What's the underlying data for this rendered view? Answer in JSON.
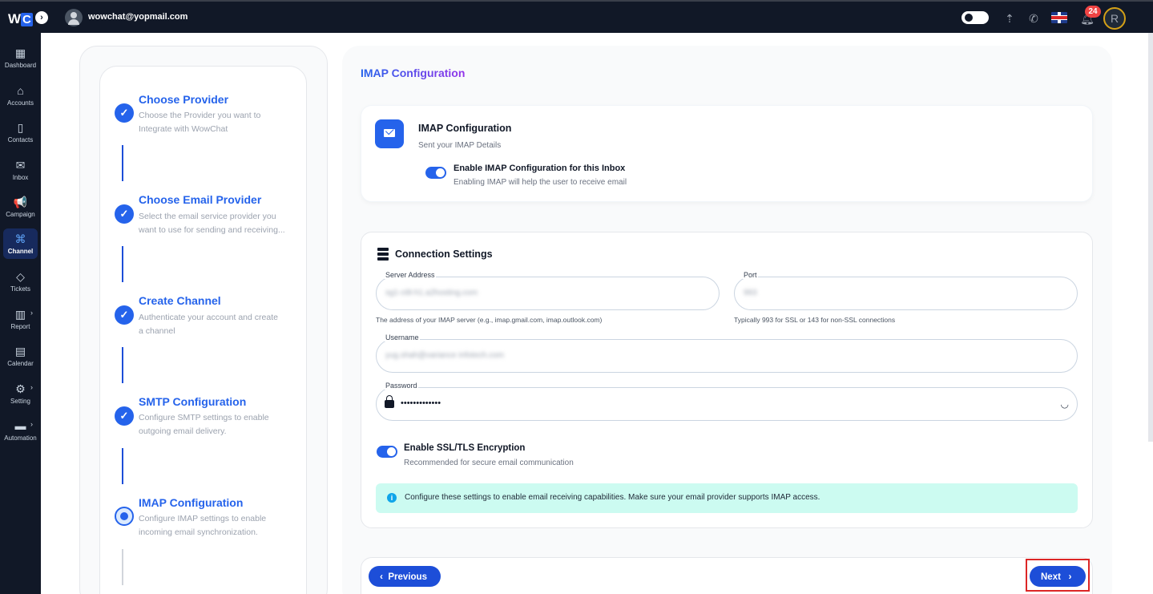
{
  "topbar": {
    "logo_w": "W",
    "logo_c": "C",
    "logo_toggle": "›",
    "user_email": "wowchat@yopmail.com",
    "notification_count": "24",
    "profile_initial": "R"
  },
  "sidebar": {
    "items": [
      {
        "label": "Dashboard",
        "icon": "dashboard-icon",
        "glyph": "▦"
      },
      {
        "label": "Accounts",
        "icon": "home-icon",
        "glyph": "⌂"
      },
      {
        "label": "Contacts",
        "icon": "contacts-icon",
        "glyph": "▯"
      },
      {
        "label": "Inbox",
        "icon": "inbox-icon",
        "glyph": "✉"
      },
      {
        "label": "Campaign",
        "icon": "campaign-icon",
        "glyph": "📢"
      },
      {
        "label": "Channel",
        "icon": "channel-icon",
        "glyph": "⌘"
      },
      {
        "label": "Tickets",
        "icon": "ticket-icon",
        "glyph": "◇"
      },
      {
        "label": "Report",
        "icon": "report-icon",
        "glyph": "▥"
      },
      {
        "label": "Calendar",
        "icon": "calendar-icon",
        "glyph": "▤"
      },
      {
        "label": "Setting",
        "icon": "gear-icon",
        "glyph": "⚙"
      },
      {
        "label": "Automation",
        "icon": "automation-icon",
        "glyph": "▬"
      }
    ]
  },
  "stepper": {
    "steps": [
      {
        "title": "Choose Provider",
        "desc1": "Choose the Provider you want to",
        "desc2": "Integrate with WowChat",
        "status": "done"
      },
      {
        "title": "Choose Email Provider",
        "desc1": "Select the email service provider you",
        "desc2": "want to use for sending and receiving...",
        "status": "done"
      },
      {
        "title": "Create Channel",
        "desc1": "Authenticate your account and create",
        "desc2": "a channel",
        "status": "done"
      },
      {
        "title": "SMTP Configuration",
        "desc1": "Configure SMTP settings to enable",
        "desc2": "outgoing email delivery.",
        "status": "done"
      },
      {
        "title": "IMAP Configuration",
        "desc1": "Configure IMAP settings to enable",
        "desc2": "incoming email synchronization.",
        "status": "current"
      }
    ]
  },
  "page": {
    "title": "IMAP Configuration"
  },
  "imap_card": {
    "title": "IMAP Configuration",
    "subtitle": "Sent your IMAP Details",
    "toggle_label": "Enable IMAP Configuration for this Inbox",
    "toggle_sub": "Enabling IMAP will help the user to receive email",
    "toggle_on": true
  },
  "connection": {
    "title": "Connection Settings",
    "server_label": "Server Address",
    "server_value": "sg1-ct8-h1.a2hosting.com",
    "server_help": "The address of your IMAP server (e.g., imap.gmail.com, imap.outlook.com)",
    "port_label": "Port",
    "port_value": "993",
    "port_help": "Typically 993 for SSL or 143 for non-SSL connections",
    "username_label": "Username",
    "username_value": "yug.shah@variance infotech.com",
    "password_label": "Password",
    "password_value": "•••••••••••••",
    "ssl_label": "Enable SSL/TLS Encryption",
    "ssl_sub": "Recommended for secure email communication",
    "ssl_on": true,
    "info_text": "Configure these settings to enable email receiving capabilities. Make sure your email provider supports IMAP access."
  },
  "footer": {
    "prev_label": "Previous",
    "next_label": "Next",
    "prev_arrow": "‹",
    "next_arrow": "›"
  },
  "colors": {
    "accent": "#2563eb",
    "sidebar_bg": "#111827",
    "highlight": "#dc2626"
  }
}
